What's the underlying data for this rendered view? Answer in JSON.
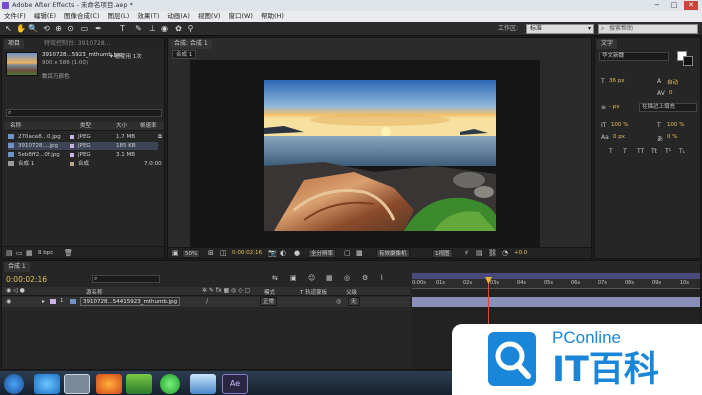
{
  "title": "Adobe After Effects - 未命名项目.aep *",
  "window_buttons": [
    "−",
    "□",
    "✕"
  ],
  "menu": [
    "文件(F)",
    "编辑(E)",
    "图像合成(C)",
    "图层(L)",
    "效果(T)",
    "动画(A)",
    "视图(V)",
    "窗口(W)",
    "帮助(H)"
  ],
  "toolbar": {
    "tools": [
      "↖",
      "✋",
      "🔍",
      "⟲",
      "⊕",
      "⊙",
      "▭",
      "✒",
      "T",
      "✎",
      "⊥",
      "◉",
      "✿",
      "⚲"
    ],
    "workspace_label": "工作区:",
    "workspace_value": "标准",
    "search_placeholder": "搜索帮助"
  },
  "project": {
    "tab_project": "项目",
    "tab_effects": "特效控制台: 3910728...",
    "file_name": "3910728...5923_mthumb.jpg",
    "used_count": "▾ 被使用 1次",
    "dims": "900 x 586 (1.00)",
    "color": "数百万颜色",
    "col_name": "名称",
    "col_type": "类型",
    "col_size": "大小",
    "col_fps": "帧速率",
    "items": [
      {
        "name": "270ace8...0.jpg",
        "type": "JPEG",
        "size": "1.7 MB",
        "fps": ""
      },
      {
        "name": "3910728....jpg",
        "type": "JPEG",
        "size": "185 KB",
        "fps": ""
      },
      {
        "name": "5eb8ff2...0f.jpg",
        "type": "JPEG",
        "size": "3.1 MB",
        "fps": ""
      },
      {
        "name": "合成 1",
        "type": "合成",
        "size": "",
        "fps": "7.0:00"
      }
    ],
    "bpc": "8 bpc"
  },
  "composition": {
    "tab": "合成: 合成 1",
    "subtab": "合成 1",
    "zoom": "50%",
    "timecode": "0:00:02:16",
    "resolution": "全分辨率",
    "camera": "有效摄像机",
    "views": "1视图",
    "exposure": "+0.0"
  },
  "character": {
    "tab": "文字",
    "font": "华文新魏",
    "size": "36 px",
    "leading": "自动",
    "kerning": "0",
    "stroke_px": "- px",
    "stroke_mode": "在描边上填充",
    "scale_v": "100 %",
    "scale_h": "100 %",
    "baseline": "0 px",
    "tsume": "0 %",
    "styles": [
      "T",
      "T",
      "TT",
      "Tt",
      "T¹",
      "T₁"
    ]
  },
  "timeline": {
    "tab": "合成 1",
    "timecode": "0:00:02:16",
    "col_source": "源名称",
    "col_mode": "模式",
    "col_trkmat": "T  轨道蒙板",
    "col_parent": "父级",
    "layer_index": "1",
    "layer_name": "3910728...54415923_mthumb.jpg",
    "layer_mode": "正常",
    "layer_parent": "无",
    "ruler_ticks": [
      "0:00s",
      "01s",
      "02s",
      "03s",
      "04s",
      "05s",
      "06s",
      "07s",
      "08s",
      "09s",
      "10s"
    ],
    "playhead_fraction": 0.264
  },
  "watermark": {
    "brand": "PConline",
    "title": "IT百科"
  }
}
